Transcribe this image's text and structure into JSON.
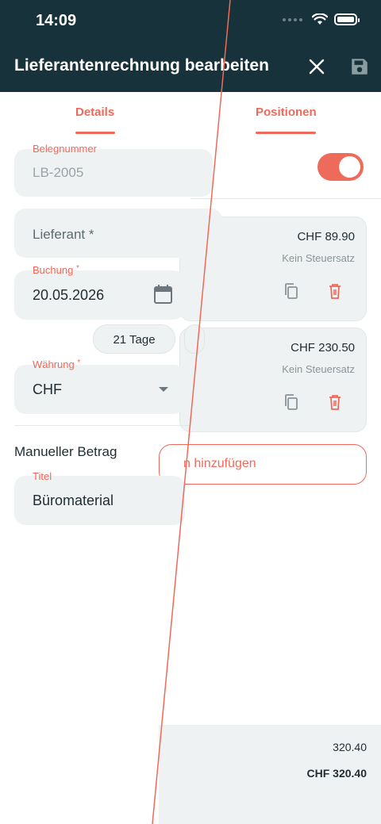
{
  "status_bar": {
    "time": "14:09"
  },
  "header": {
    "title": "Lieferantenrechnung bearbeiten",
    "close_icon": "close-icon",
    "save_icon": "save-icon"
  },
  "tabs": [
    {
      "label": "Details",
      "active": true
    },
    {
      "label": "Positionen",
      "active": true
    }
  ],
  "details": {
    "belegnummer": {
      "label": "Belegnummer",
      "value": "LB-2005"
    },
    "lieferant": {
      "placeholder": "Lieferant *"
    },
    "buchung": {
      "label": "Buchung",
      "required_mark": "*",
      "value": "20.05.2026"
    },
    "chips": [
      "21 Tage"
    ],
    "waehrung": {
      "label": "Währung",
      "required_mark": "*",
      "value": "CHF"
    },
    "manual_section": "Manueller Betrag",
    "titel": {
      "label": "Titel",
      "value": "Büromaterial"
    }
  },
  "positions": {
    "toggle_on": true,
    "items": [
      {
        "amount": "CHF 89.90",
        "tax": "Kein Steuersatz"
      },
      {
        "amount": "CHF 230.50",
        "tax": "Kein Steuersatz"
      }
    ],
    "add_button": "n hinzufügen",
    "total_net": "320.40",
    "total_gross": "CHF 320.40"
  },
  "colors": {
    "header_bg": "#17323a",
    "accent": "#ee6a5a",
    "field_bg": "#eef2f2",
    "text": "#1f2d33",
    "muted": "#8a9599"
  }
}
